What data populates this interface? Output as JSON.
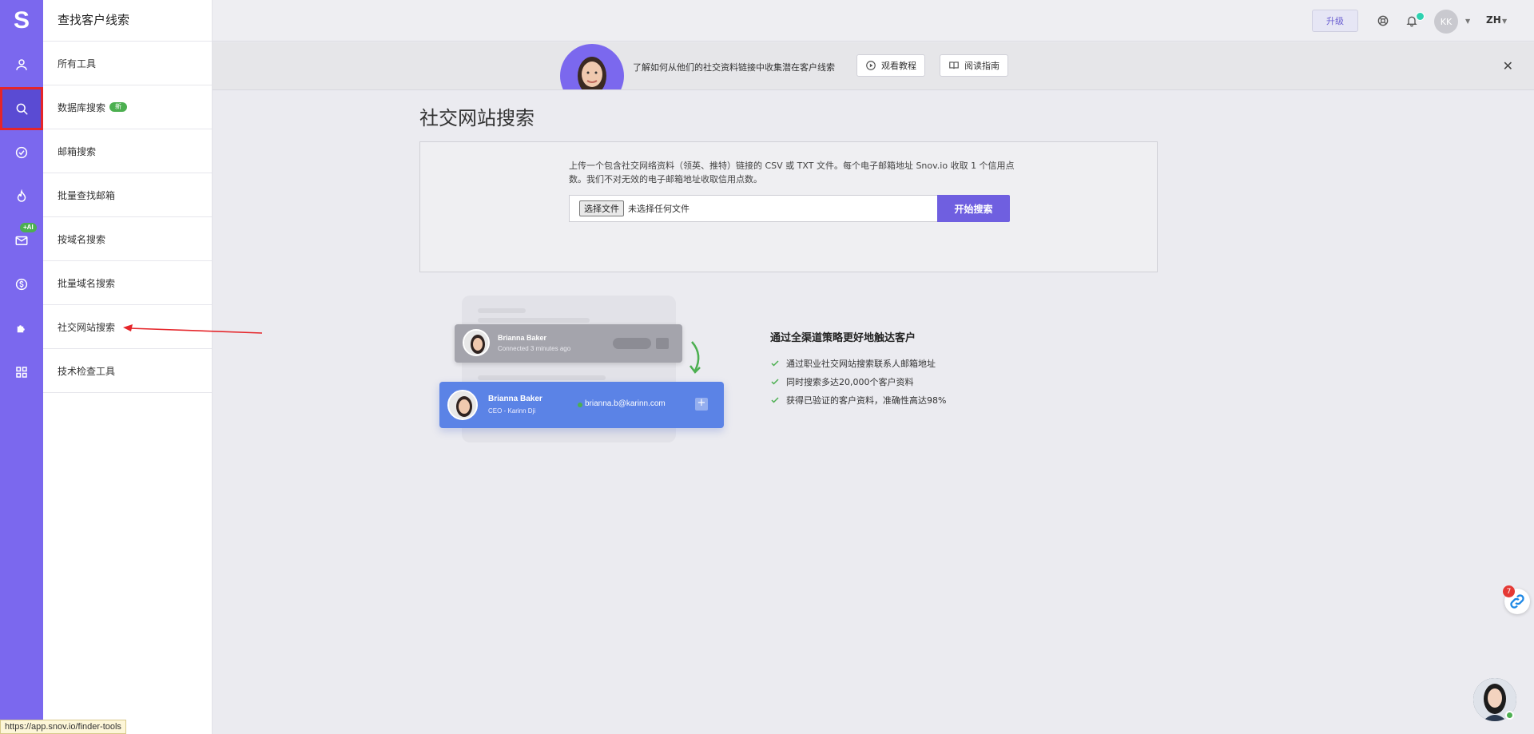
{
  "rail": {
    "logo": "S",
    "ai_badge": "+AI"
  },
  "menu": {
    "title": "查找客户线索",
    "items": [
      {
        "label": "所有工具"
      },
      {
        "label": "数据库搜索",
        "badge": "新"
      },
      {
        "label": "邮箱搜索"
      },
      {
        "label": "批量查找邮箱"
      },
      {
        "label": "按域名搜索"
      },
      {
        "label": "批量域名搜索"
      },
      {
        "label": "社交网站搜索"
      },
      {
        "label": "技术检查工具"
      }
    ]
  },
  "topbar": {
    "upgrade_label": "升级",
    "avatar_initials": "KK",
    "language": "ZH"
  },
  "banner": {
    "text": "了解如何从他们的社交资料链接中收集潜在客户线索",
    "watch_label": "观看教程",
    "read_label": "阅读指南"
  },
  "main": {
    "title": "社交网站搜索",
    "description": "上传一个包含社交网络资料（领英、推特）链接的 CSV 或 TXT 文件。每个电子邮箱地址 Snov.io 收取 1 个信用点数。我们不对无效的电子邮箱地址收取信用点数。",
    "choose_file_label": "选择文件",
    "no_file_label": "未选择任何文件",
    "start_label": "开始搜索"
  },
  "illustration": {
    "grey_card": {
      "name": "Brianna Baker",
      "sub": "Connected 3 minutes ago"
    },
    "blue_card": {
      "name": "Brianna Baker",
      "sub": "CEO - Karinn Dji",
      "email": "brianna.b@karinn.com"
    }
  },
  "benefits": {
    "title": "通过全渠道策略更好地触达客户",
    "items": [
      "通过职业社交网站搜索联系人邮箱地址",
      "同时搜索多达20,000个客户资料",
      "获得已验证的客户资料，准确性高达98%"
    ]
  },
  "widgets": {
    "chat_count": "7"
  },
  "status_bar": {
    "url": "https://app.snov.io/finder-tools"
  },
  "colors": {
    "brand": "#7b68ee",
    "primary_button": "#6f5fe0",
    "success": "#4caf50",
    "highlight": "#e5252a"
  }
}
